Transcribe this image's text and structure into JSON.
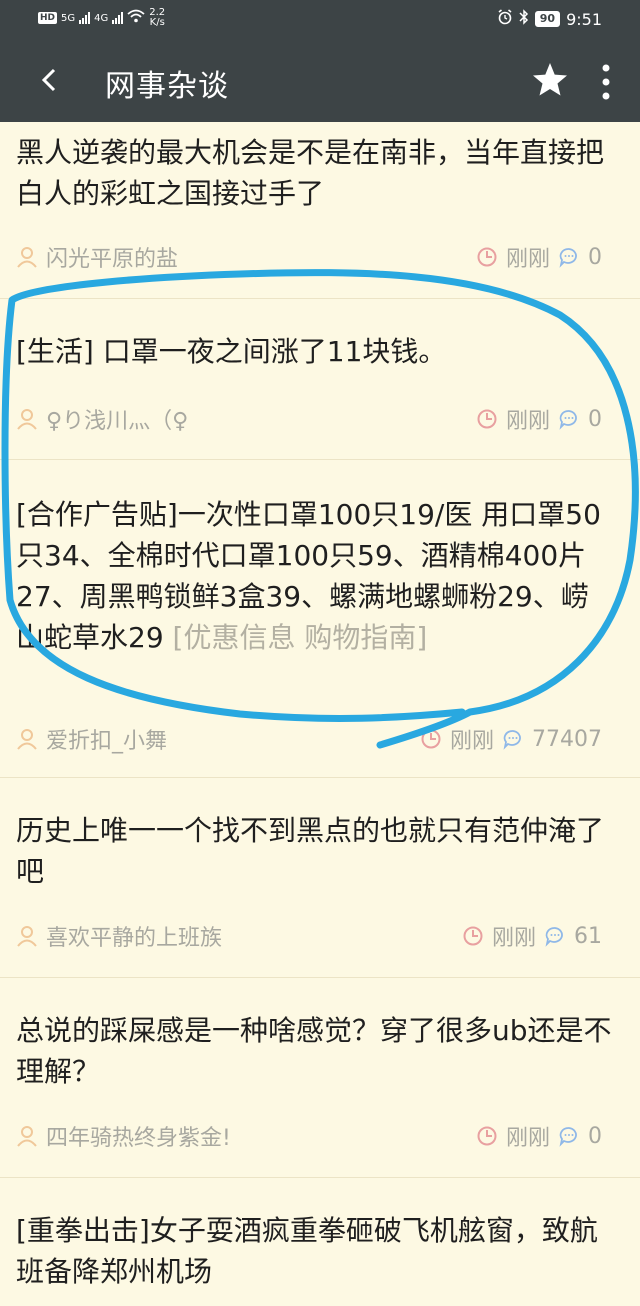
{
  "status_bar": {
    "hd": "HD",
    "sig1": "5G",
    "sig2": "4G",
    "speed_top": "2.2",
    "speed_unit": "K/s",
    "battery": "90",
    "time": "9:51"
  },
  "app_bar": {
    "title": "网事杂谈"
  },
  "posts": [
    {
      "title": "黑人逆袭的最大机会是不是在南非，当年直接把白人的彩虹之国接过手了",
      "author": "闪光平原的盐",
      "time": "刚刚",
      "comments": "0"
    },
    {
      "title": "[生活] 口罩一夜之间涨了11块钱。",
      "author": "♀り浅川灬（♀",
      "time": "刚刚",
      "comments": "0"
    },
    {
      "title": "[合作广告贴]一次性口罩100只19/医 用口罩50只34、全棉时代口罩100只59、酒精棉400片27、周黑鸭锁鲜3盒39、螺满地螺蛳粉29、崂山蛇草水29",
      "suffix": " [优惠信息 购物指南]",
      "author": "爱折扣_小舞",
      "time": "刚刚",
      "comments": "77407"
    },
    {
      "title": "历史上唯一一个找不到黑点的也就只有范仲淹了吧",
      "author": "喜欢平静的上班族",
      "time": "刚刚",
      "comments": "61"
    },
    {
      "title": "总说的踩屎感是一种啥感觉？穿了很多ub还是不理解？",
      "author": "四年骑热终身紫金!",
      "time": "刚刚",
      "comments": "0"
    },
    {
      "title": "[重拳出击]女子耍酒疯重拳砸破飞机舷窗，致航班备降郑州机场",
      "author": "",
      "time": "",
      "comments": ""
    }
  ],
  "colors": {
    "app_bar": "#3d4446",
    "background": "#fdf9e3",
    "annotation": "#29a8e0",
    "user_icon": "#f0c89a",
    "clock_icon": "#e8a0a0",
    "comment_icon": "#8fb8e8"
  },
  "icons": [
    "back-icon",
    "star-icon",
    "more-icon",
    "user-icon",
    "clock-icon",
    "comment-icon"
  ]
}
